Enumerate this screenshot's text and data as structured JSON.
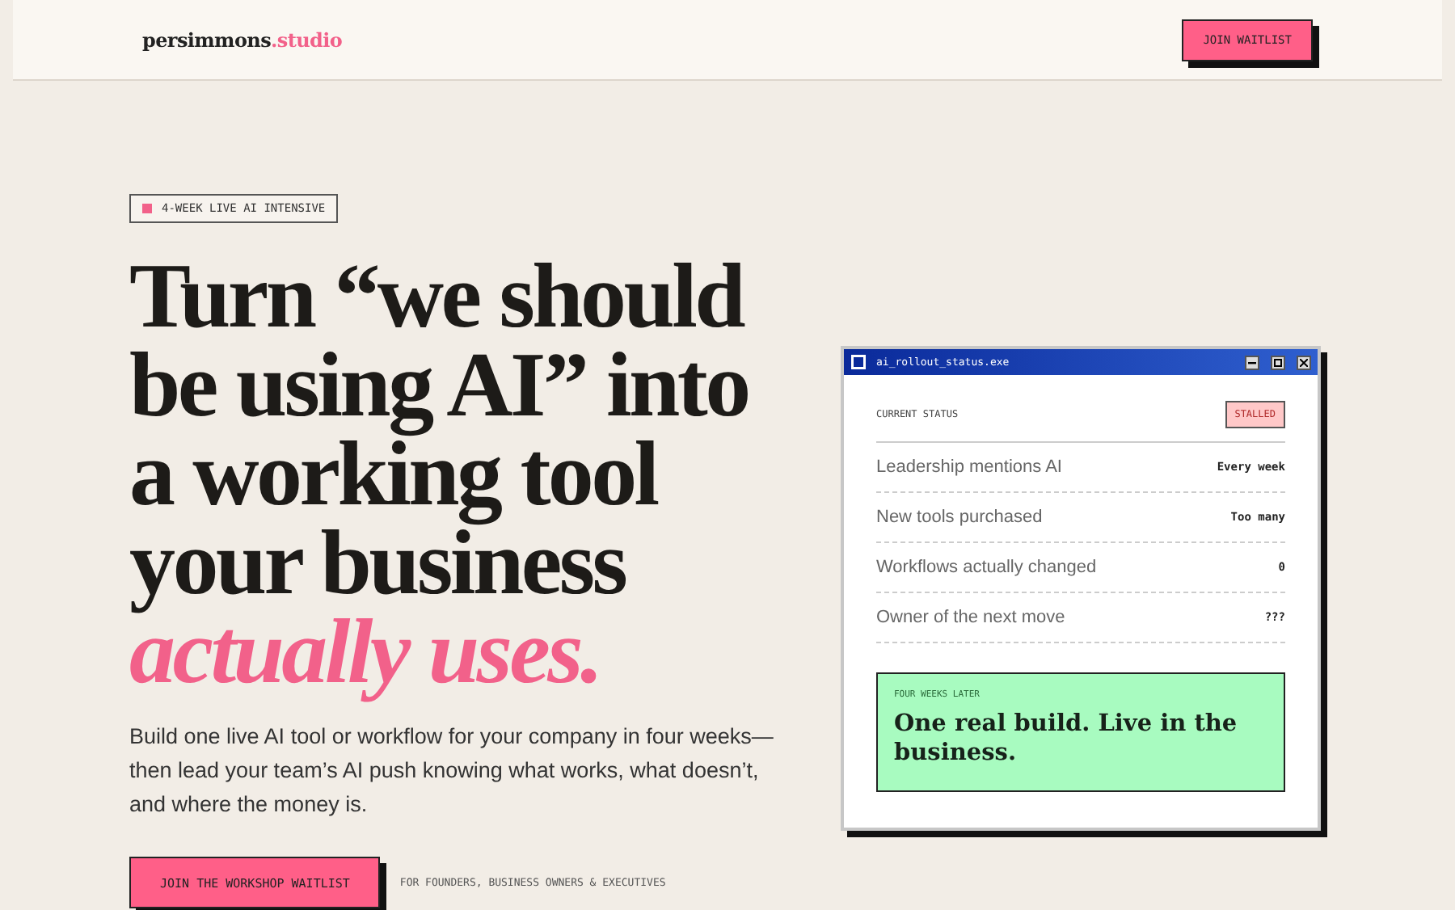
{
  "header": {
    "logo": {
      "name": "persimmons",
      "suffix": ".studio"
    },
    "cta": "JOIN WAITLIST"
  },
  "badge": "4-WEEK LIVE AI INTENSIVE",
  "headline": {
    "lines": [
      "Turn “we should",
      "be using AI” into",
      "a working tool",
      "your business"
    ],
    "accent": "actually uses."
  },
  "intro": "Build one live AI tool or workflow for your company in four weeks—then lead your team’s AI push knowing what works, what doesn’t, and where the money is.",
  "cta": {
    "button": "JOIN THE WORKSHOP WAITLIST",
    "note": "FOR FOUNDERS, BUSINESS OWNERS & EXECUTIVES"
  },
  "window": {
    "title": "ai_rollout_status.exe",
    "status_label": "CURRENT STATUS",
    "status": "STALLED",
    "rows": [
      {
        "label": "Leadership mentions AI",
        "value": "Every week"
      },
      {
        "label": "New tools purchased",
        "value": "Too many"
      },
      {
        "label": "Workflows actually changed",
        "value": "0"
      },
      {
        "label": "Owner of the next move",
        "value": "???"
      }
    ],
    "result": {
      "eyebrow": "FOUR WEEKS LATER",
      "text": "One real build. Live in the business."
    }
  }
}
